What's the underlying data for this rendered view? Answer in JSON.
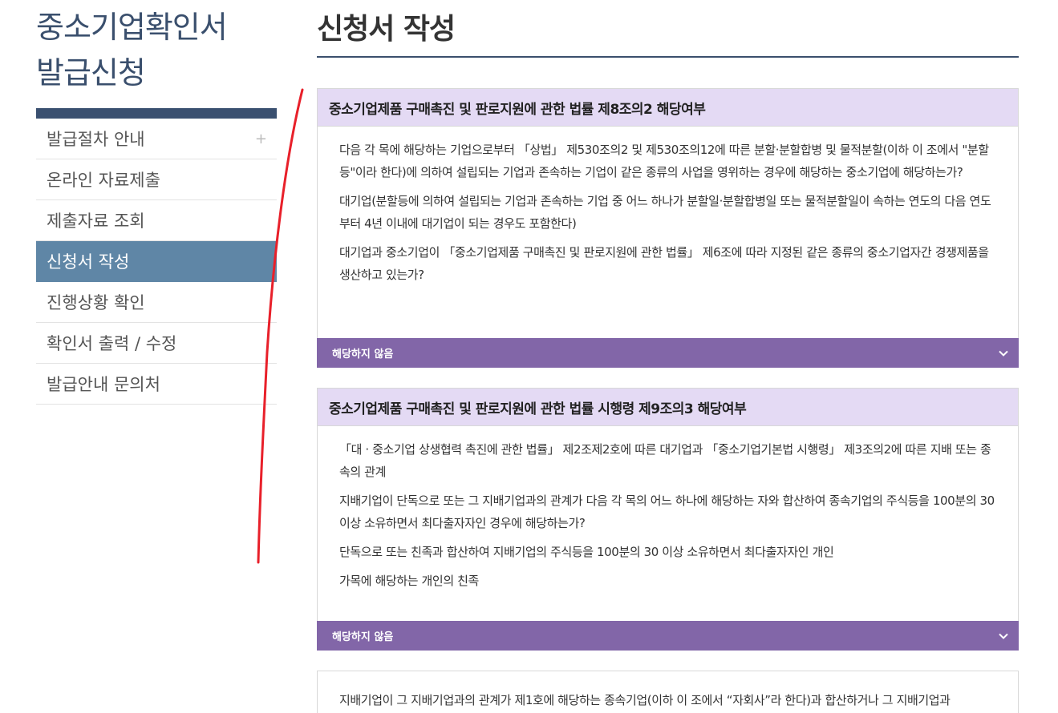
{
  "sidebar": {
    "title_line1": "중소기업확인서",
    "title_line2": "발급신청",
    "menu": [
      {
        "label": "발급절차 안내",
        "expand_icon": "+"
      },
      {
        "label": "온라인 자료제출"
      },
      {
        "label": "제출자료 조회"
      },
      {
        "label": "신청서 작성",
        "active": true
      },
      {
        "label": "진행상황 확인"
      },
      {
        "label": "확인서 출력 / 수정"
      },
      {
        "label": "발급안내 문의처"
      }
    ]
  },
  "main": {
    "page_title": "신청서 작성",
    "sections": [
      {
        "heading": "중소기업제품 구매촉진 및 판로지원에 관한 법률 제8조의2 해당여부",
        "paragraphs": [
          "다음 각 목에 해당하는 기업으로부터 「상법」 제530조의2 및 제530조의12에 따른 분할·분할합병 및 물적분할(이하 이 조에서 \"분할등\"이라 한다)에 의하여 설립되는 기업과 존속하는 기업이 같은 종류의 사업을 영위하는 경우에 해당하는 중소기업에 해당하는가?",
          "대기업(분할등에 의하여 설립되는 기업과 존속하는 기업 중 어느 하나가 분할일·분할합병일 또는 물적분할일이 속하는 연도의 다음 연도부터 4년 이내에 대기업이 되는 경우도 포함한다)",
          "대기업과 중소기업이 「중소기업제품 구매촉진 및 판로지원에 관한 법률」 제6조에 따라 지정된 같은 종류의 중소기업자간 경쟁제품을 생산하고 있는가?"
        ],
        "answer": "해당하지 않음"
      },
      {
        "heading": "중소기업제품 구매촉진 및 판로지원에 관한 법률 시행령 제9조의3 해당여부",
        "paragraphs": [
          "「대 · 중소기업 상생협력 촉진에 관한 법률」 제2조제2호에 따른 대기업과 「중소기업기본법 시행령」 제3조의2에 따른 지배 또는 종속의 관계",
          "지배기업이 단독으로 또는 그 지배기업과의 관계가 다음 각 목의 어느 하나에 해당하는 자와 합산하여 종속기업의 주식등을 100분의 30 이상 소유하면서 최다출자자인 경우에 해당하는가?",
          "단독으로 또는 친족과 합산하여 지배기업의 주식등을 100분의 30 이상 소유하면서 최다출자자인 개인",
          "가목에 해당하는 개인의 친족"
        ],
        "answer": "해당하지 않음"
      },
      {
        "paragraphs": [
          "지배기업이 그 지배기업과의 관계가 제1호에 해당하는 종속기업(이하 이 조에서 “자회사”라 한다)과 합산하거나 그 지배기업과"
        ]
      }
    ]
  },
  "colors": {
    "nav_active": "#5f86a6",
    "section_header": "#e4daf4",
    "answer_bar": "#8266a8",
    "annotation_stroke": "#e8202a"
  },
  "icons": {
    "expand": "plus-icon",
    "dropdown": "chevron-down-icon"
  }
}
